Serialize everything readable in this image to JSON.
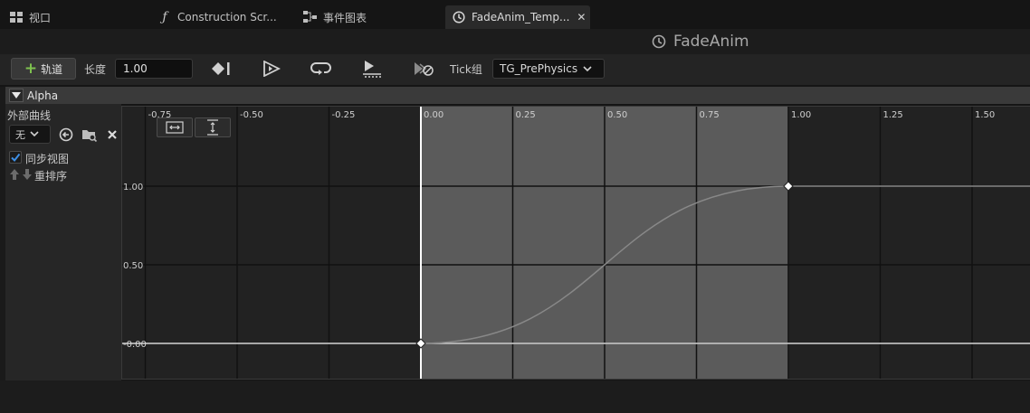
{
  "tabs": [
    {
      "label": "视口",
      "icon": "viewport-grid-icon"
    },
    {
      "label": "Construction Scr...",
      "icon": "function-icon"
    },
    {
      "label": "事件图表",
      "icon": "event-graph-icon"
    },
    {
      "label": "FadeAnim_Temp...",
      "icon": "timeline-clock-icon",
      "active": true
    }
  ],
  "asset_title": "FadeAnim",
  "toolbar": {
    "add_track_label": "轨道",
    "length_label": "长度",
    "length_value": "1.00",
    "tick_group_label": "Tick组",
    "tick_group_value": "TG_PrePhysics"
  },
  "track": {
    "name": "Alpha",
    "external_curve_label": "外部曲线",
    "curve_select_value": "无",
    "sync_view_label": "同步视图",
    "sync_view_checked": true,
    "reorder_label": "重排序"
  },
  "graph": {
    "x_ticks": [
      "-0.75",
      "-0.50",
      "-0.25",
      "0.00",
      "0.25",
      "0.50",
      "0.75",
      "1.00",
      "1.25",
      "1.50"
    ],
    "y_ticks": [
      "1.00",
      "0.50",
      "-0.00"
    ],
    "range_start": 0.0,
    "range_end": 1.0,
    "keyframes": [
      {
        "time": 0.0,
        "value": 0.0
      },
      {
        "time": 1.0,
        "value": 1.0
      }
    ],
    "colors": {
      "background": "#222222",
      "active_range": "#5b5b5b",
      "grid": "#111111",
      "curve": "#888888",
      "flat_curve": "#d8d8d8",
      "key": "#ffffff"
    }
  }
}
